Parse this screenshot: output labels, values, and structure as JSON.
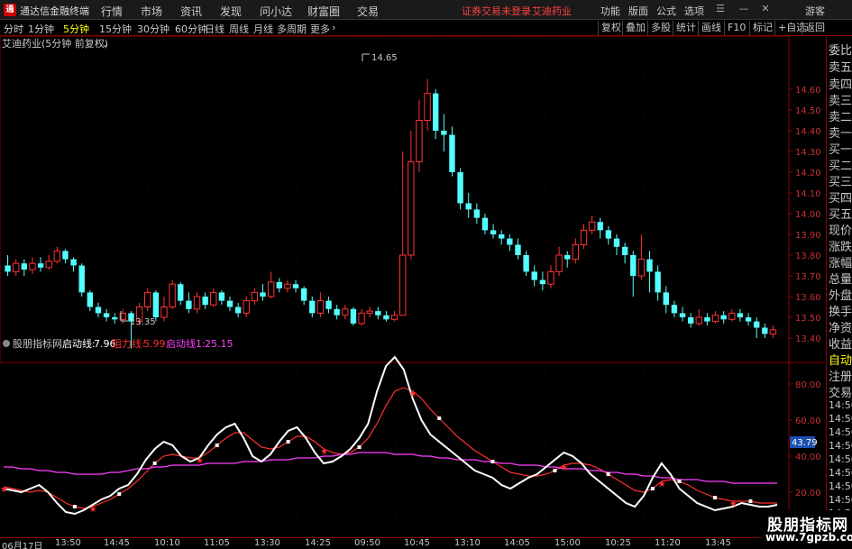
{
  "titlebar": {
    "app_name": "通达信金融终端",
    "menus": [
      "行情",
      "市场",
      "资讯",
      "发现",
      "问小达",
      "财富圈",
      "交易"
    ],
    "notice_trade": "证券交易未登录",
    "notice_stock": "艾迪药业",
    "right_menus": [
      "功能",
      "版面",
      "公式",
      "选项"
    ],
    "guest": "游客"
  },
  "toolbar": {
    "periods": [
      "分时",
      "1分钟",
      "5分钟",
      "15分钟",
      "30分钟",
      "60分钟",
      "日线",
      "周线",
      "月线",
      "多周期",
      "更多"
    ],
    "active_period": "5分钟",
    "right_buttons": [
      "复权",
      "叠加",
      "多股",
      "统计",
      "画线",
      "F10",
      "标记",
      "+自选",
      "返回"
    ]
  },
  "price_chart": {
    "title": "艾迪药业(5分钟 前复权)",
    "high_label": "14.65",
    "low_label": "13.35",
    "y_ticks": [
      "14.60",
      "14.50",
      "14.40",
      "14.30",
      "14.20",
      "14.10",
      "14.00",
      "13.90",
      "13.80",
      "13.70",
      "13.60",
      "13.50",
      "13.40"
    ]
  },
  "indicator": {
    "name": "股朋指标网",
    "line1_label": "启动线:",
    "line1_value": "7.96",
    "line2_label": "阻力线:",
    "line2_value": "5.99",
    "line3_label": "启动线1:",
    "line3_value": "25.15",
    "y_ticks": [
      "80.00",
      "60.00",
      "40.00",
      "20.00"
    ],
    "current_value": "43.79",
    "colors": {
      "line1": "#ffffff",
      "line2": "#ff3030",
      "line3": "#ff40ff"
    }
  },
  "right_panel": {
    "labels": [
      "委比",
      "卖五",
      "卖四",
      "卖三",
      "卖二",
      "卖一",
      "买一",
      "买二",
      "买三",
      "买四",
      "买五",
      "现价",
      "涨跌",
      "涨幅",
      "总量",
      "外盘",
      "换手",
      "净资",
      "收益"
    ],
    "lower_labels": [
      "自动",
      "注册",
      "交易"
    ],
    "times": [
      "14:56",
      "14:56",
      "14:56",
      "14:56",
      "14:56",
      "14:56",
      "14:56",
      "14:56",
      "14:56"
    ]
  },
  "time_axis": [
    "06月17日",
    "13:50",
    "14:45",
    "10:10",
    "11:05",
    "13:30",
    "14:25",
    "09:50",
    "10:45",
    "13:10",
    "14:05",
    "15:00",
    "10:25",
    "11:20",
    "13:45"
  ],
  "watermark": {
    "line1": "股朋指标网",
    "line2": "www.7gpzb.com"
  },
  "chart_data": [
    {
      "type": "candlestick",
      "title": "艾迪药业(5分钟 前复权)",
      "ylim": [
        13.35,
        14.65
      ],
      "candles": [
        [
          13.75,
          13.72,
          13.8,
          13.7
        ],
        [
          13.72,
          13.76,
          13.78,
          13.7
        ],
        [
          13.76,
          13.73,
          13.78,
          13.7
        ],
        [
          13.73,
          13.76,
          13.79,
          13.71
        ],
        [
          13.76,
          13.74,
          13.79,
          13.72
        ],
        [
          13.74,
          13.77,
          13.8,
          13.73
        ],
        [
          13.77,
          13.82,
          13.84,
          13.76
        ],
        [
          13.82,
          13.78,
          13.83,
          13.76
        ],
        [
          13.78,
          13.75,
          13.79,
          13.72
        ],
        [
          13.75,
          13.62,
          13.76,
          13.6
        ],
        [
          13.62,
          13.55,
          13.63,
          13.53
        ],
        [
          13.55,
          13.52,
          13.57,
          13.5
        ],
        [
          13.52,
          13.5,
          13.54,
          13.48
        ],
        [
          13.5,
          13.49,
          13.52,
          13.47
        ],
        [
          13.49,
          13.52,
          13.54,
          13.47
        ],
        [
          13.52,
          13.48,
          13.53,
          13.35
        ],
        [
          13.48,
          13.55,
          13.57,
          13.46
        ],
        [
          13.55,
          13.62,
          13.64,
          13.53
        ],
        [
          13.62,
          13.5,
          13.63,
          13.48
        ],
        [
          13.5,
          13.55,
          13.6,
          13.48
        ],
        [
          13.55,
          13.66,
          13.68,
          13.54
        ],
        [
          13.66,
          13.58,
          13.67,
          13.56
        ],
        [
          13.58,
          13.54,
          13.62,
          13.52
        ],
        [
          13.54,
          13.6,
          13.62,
          13.52
        ],
        [
          13.6,
          13.56,
          13.62,
          13.54
        ],
        [
          13.56,
          13.62,
          13.64,
          13.55
        ],
        [
          13.62,
          13.58,
          13.63,
          13.56
        ],
        [
          13.58,
          13.55,
          13.6,
          13.53
        ],
        [
          13.55,
          13.52,
          13.57,
          13.5
        ],
        [
          13.52,
          13.58,
          13.6,
          13.5
        ],
        [
          13.58,
          13.62,
          13.64,
          13.56
        ],
        [
          13.62,
          13.6,
          13.66,
          13.58
        ],
        [
          13.6,
          13.67,
          13.72,
          13.59
        ],
        [
          13.67,
          13.64,
          13.69,
          13.62
        ],
        [
          13.64,
          13.66,
          13.68,
          13.62
        ],
        [
          13.66,
          13.64,
          13.68,
          13.62
        ],
        [
          13.64,
          13.58,
          13.65,
          13.56
        ],
        [
          13.58,
          13.52,
          13.6,
          13.5
        ],
        [
          13.52,
          13.58,
          13.62,
          13.5
        ],
        [
          13.58,
          13.54,
          13.6,
          13.52
        ],
        [
          13.54,
          13.51,
          13.56,
          13.49
        ],
        [
          13.51,
          13.54,
          13.56,
          13.49
        ],
        [
          13.54,
          13.47,
          13.55,
          13.46
        ],
        [
          13.47,
          13.52,
          13.54,
          13.46
        ],
        [
          13.52,
          13.53,
          13.55,
          13.5
        ],
        [
          13.53,
          13.51,
          13.55,
          13.49
        ],
        [
          13.51,
          13.49,
          13.53,
          13.48
        ],
        [
          13.49,
          13.51,
          13.53,
          13.48
        ],
        [
          13.51,
          13.8,
          14.3,
          13.8
        ],
        [
          13.8,
          14.25,
          14.4,
          13.78
        ],
        [
          14.25,
          14.45,
          14.55,
          14.2
        ],
        [
          14.45,
          14.58,
          14.65,
          14.4
        ],
        [
          14.58,
          14.4,
          14.6,
          14.36
        ],
        [
          14.4,
          14.38,
          14.48,
          14.3
        ],
        [
          14.38,
          14.2,
          14.42,
          14.18
        ],
        [
          14.2,
          14.05,
          14.22,
          14.02
        ],
        [
          14.05,
          14.02,
          14.1,
          13.98
        ],
        [
          14.02,
          13.98,
          14.05,
          13.95
        ],
        [
          13.98,
          13.92,
          14.0,
          13.9
        ],
        [
          13.92,
          13.9,
          13.95,
          13.88
        ],
        [
          13.9,
          13.88,
          13.92,
          13.85
        ],
        [
          13.88,
          13.85,
          13.9,
          13.82
        ],
        [
          13.85,
          13.8,
          13.88,
          13.78
        ],
        [
          13.8,
          13.72,
          13.82,
          13.7
        ],
        [
          13.72,
          13.68,
          13.75,
          13.65
        ],
        [
          13.68,
          13.66,
          13.72,
          13.63
        ],
        [
          13.66,
          13.72,
          13.75,
          13.64
        ],
        [
          13.72,
          13.8,
          13.84,
          13.7
        ],
        [
          13.8,
          13.78,
          13.82,
          13.74
        ],
        [
          13.78,
          13.85,
          13.88,
          13.76
        ],
        [
          13.85,
          13.92,
          13.95,
          13.83
        ],
        [
          13.92,
          13.96,
          13.99,
          13.9
        ],
        [
          13.96,
          13.92,
          13.98,
          13.88
        ],
        [
          13.92,
          13.88,
          13.94,
          13.85
        ],
        [
          13.88,
          13.84,
          13.9,
          13.8
        ],
        [
          13.84,
          13.8,
          13.86,
          13.76
        ],
        [
          13.8,
          13.7,
          13.82,
          13.6
        ],
        [
          13.7,
          13.78,
          13.9,
          13.68
        ],
        [
          13.78,
          13.72,
          13.82,
          13.62
        ],
        [
          13.72,
          13.62,
          13.75,
          13.58
        ],
        [
          13.62,
          13.56,
          13.65,
          13.52
        ],
        [
          13.56,
          13.52,
          13.58,
          13.5
        ],
        [
          13.52,
          13.5,
          13.55,
          13.48
        ],
        [
          13.5,
          13.47,
          13.52,
          13.45
        ],
        [
          13.47,
          13.5,
          13.54,
          13.46
        ],
        [
          13.5,
          13.48,
          13.52,
          13.46
        ],
        [
          13.48,
          13.51,
          13.53,
          13.47
        ],
        [
          13.51,
          13.49,
          13.53,
          13.47
        ],
        [
          13.49,
          13.52,
          13.54,
          13.48
        ],
        [
          13.52,
          13.5,
          13.54,
          13.48
        ],
        [
          13.5,
          13.48,
          13.52,
          13.46
        ],
        [
          13.48,
          13.45,
          13.5,
          13.4
        ],
        [
          13.45,
          13.42,
          13.47,
          13.4
        ],
        [
          13.42,
          13.44,
          13.46,
          13.4
        ]
      ],
      "high": 14.65,
      "low": 13.35
    },
    {
      "type": "line",
      "ylim": [
        5,
        100
      ],
      "series": [
        {
          "name": "启动线",
          "values": [
            22,
            21,
            20,
            22,
            24,
            20,
            14,
            9,
            8,
            10,
            13,
            16,
            18,
            22,
            24,
            30,
            38,
            44,
            48,
            46,
            40,
            37,
            39,
            46,
            52,
            56,
            58,
            50,
            40,
            37,
            41,
            48,
            54,
            56,
            50,
            42,
            36,
            37,
            40,
            44,
            50,
            58,
            76,
            90,
            95,
            88,
            72,
            60,
            52,
            48,
            44,
            40,
            36,
            32,
            30,
            28,
            24,
            22,
            25,
            28,
            30,
            34,
            38,
            42,
            40,
            36,
            30,
            26,
            22,
            18,
            14,
            12,
            18,
            28,
            36,
            30,
            22,
            18,
            14,
            12,
            10,
            11,
            12,
            14,
            13,
            12,
            12,
            13
          ]
        },
        {
          "name": "阻力线",
          "values": [
            23,
            22,
            21,
            20,
            21,
            20,
            17,
            14,
            12,
            11,
            12,
            14,
            16,
            19,
            22,
            26,
            31,
            36,
            40,
            41,
            40,
            39,
            39,
            42,
            46,
            50,
            53,
            53,
            49,
            45,
            44,
            45,
            48,
            51,
            51,
            48,
            44,
            42,
            41,
            42,
            45,
            50,
            58,
            68,
            76,
            78,
            76,
            72,
            66,
            61,
            56,
            51,
            47,
            43,
            40,
            37,
            34,
            31,
            30,
            29,
            29,
            30,
            32,
            35,
            36,
            36,
            35,
            33,
            30,
            27,
            24,
            21,
            20,
            22,
            26,
            27,
            26,
            24,
            21,
            19,
            17,
            16,
            15,
            15,
            15,
            14,
            14,
            14
          ]
        },
        {
          "name": "启动线1",
          "values": [
            34,
            34,
            33,
            33,
            32,
            32,
            31,
            31,
            30,
            30,
            30,
            30,
            31,
            31,
            32,
            33,
            33,
            34,
            34,
            35,
            35,
            35,
            35,
            36,
            36,
            36,
            36,
            37,
            37,
            37,
            38,
            38,
            38,
            39,
            39,
            39,
            40,
            40,
            41,
            41,
            42,
            42,
            42,
            42,
            41,
            41,
            41,
            40,
            40,
            39,
            39,
            38,
            38,
            38,
            37,
            37,
            36,
            36,
            35,
            35,
            35,
            34,
            34,
            33,
            33,
            33,
            32,
            32,
            31,
            31,
            30,
            30,
            29,
            29,
            28,
            28,
            27,
            27,
            27,
            26,
            26,
            26,
            25,
            25,
            25,
            25,
            25,
            25
          ]
        }
      ]
    }
  ]
}
